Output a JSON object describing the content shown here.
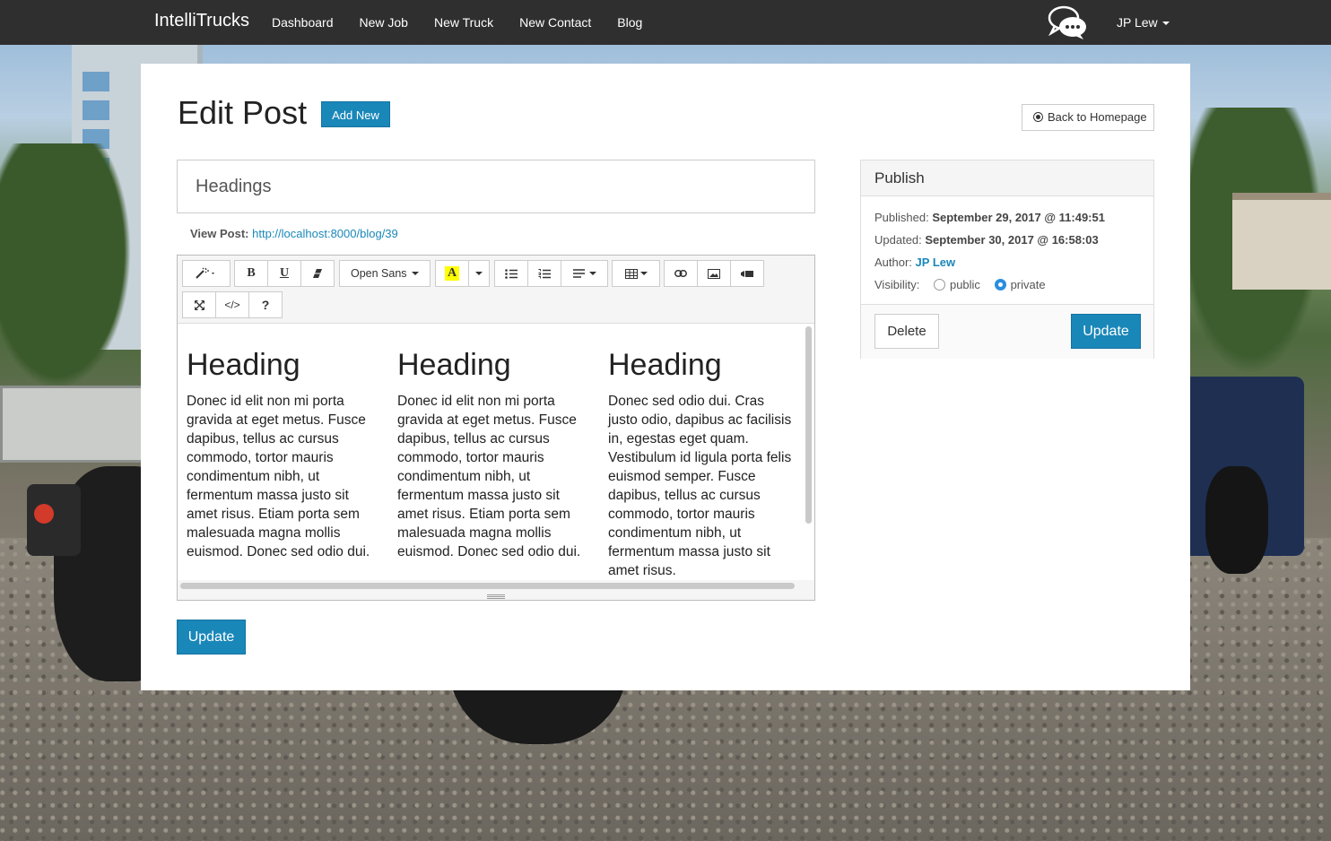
{
  "navbar": {
    "brand": "IntelliTrucks",
    "links": [
      "Dashboard",
      "New Job",
      "New Truck",
      "New Contact",
      "Blog"
    ],
    "user": "JP Lew"
  },
  "page": {
    "title": "Edit Post",
    "add_new_label": "Add New",
    "back_label": "Back to Homepage"
  },
  "post": {
    "title_value": "Headings",
    "view_post_label": "View Post:",
    "view_post_url": "http://localhost:8000/blog/39"
  },
  "editor": {
    "font_name": "Open Sans",
    "toolbar_icons": [
      "magic-icon",
      "bold-icon",
      "underline-icon",
      "eraser-icon",
      "font-family-dropdown",
      "text-color-icon",
      "color-caret-icon",
      "unordered-list-icon",
      "ordered-list-icon",
      "align-icon",
      "table-icon",
      "link-icon",
      "picture-icon",
      "video-icon",
      "fullscreen-icon",
      "code-view-icon",
      "help-icon"
    ],
    "bold_label": "B",
    "underline_label": "U",
    "color_label": "A",
    "help_label": "?",
    "code_label": "</>",
    "columns": [
      {
        "heading": "Heading",
        "text": "Donec id elit non mi porta gravida at eget metus. Fusce dapibus, tellus ac cursus commodo, tortor mauris condimentum nibh, ut fermentum massa justo sit amet risus. Etiam porta sem malesuada magna mollis euismod. Donec sed odio dui."
      },
      {
        "heading": "Heading",
        "text": "Donec id elit non mi porta gravida at eget metus. Fusce dapibus, tellus ac cursus commodo, tortor mauris condimentum nibh, ut fermentum massa justo sit amet risus. Etiam porta sem malesuada magna mollis euismod. Donec sed odio dui."
      },
      {
        "heading": "Heading",
        "text": "Donec sed odio dui. Cras justo odio, dapibus ac facilisis in, egestas eget quam. Vestibulum id ligula porta felis euismod semper. Fusce dapibus, tellus ac cursus commodo, tortor mauris condimentum nibh, ut fermentum massa justo sit amet risus."
      }
    ],
    "update_label": "Update"
  },
  "publish": {
    "title": "Publish",
    "published_label": "Published:",
    "published_value": "September 29, 2017 @ 11:49:51",
    "updated_label": "Updated:",
    "updated_value": "September 30, 2017 @ 16:58:03",
    "author_label": "Author:",
    "author_value": "JP Lew",
    "visibility_label": "Visibility:",
    "visibility_options": [
      "public",
      "private"
    ],
    "visibility_selected": "private",
    "delete_label": "Delete",
    "update_label": "Update"
  },
  "colors": {
    "navbar": "#2f2f2f",
    "primary": "#1a87b9",
    "link": "#1a87b9"
  }
}
